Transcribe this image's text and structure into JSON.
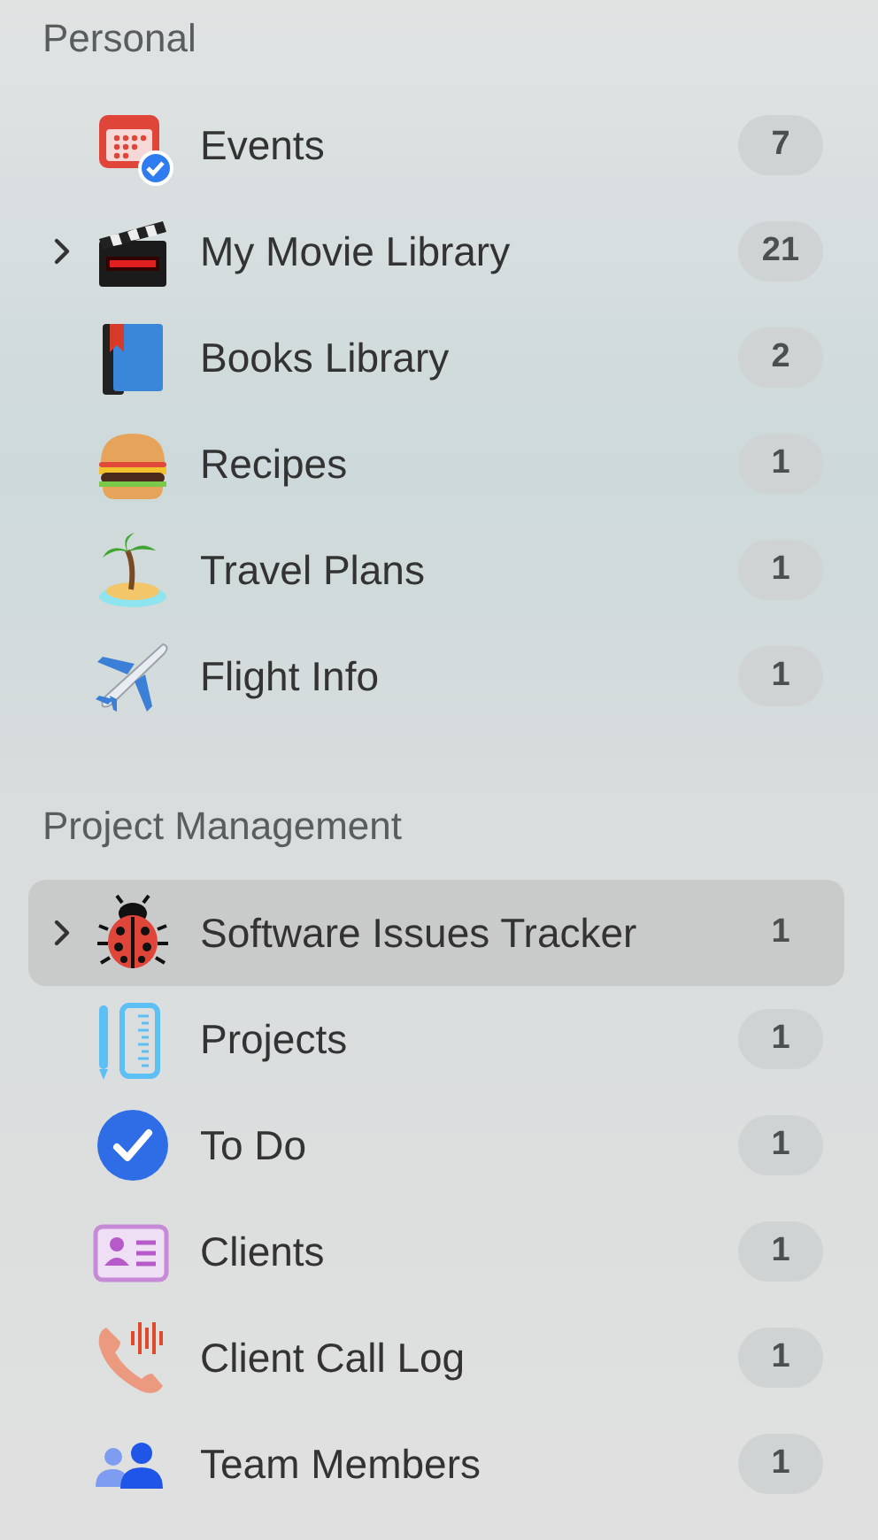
{
  "sections": [
    {
      "title": "Personal",
      "items": [
        {
          "label": "Events",
          "count": "7",
          "expandable": false,
          "selected": false
        },
        {
          "label": "My Movie Library",
          "count": "21",
          "expandable": true,
          "selected": false
        },
        {
          "label": "Books Library",
          "count": "2",
          "expandable": false,
          "selected": false
        },
        {
          "label": "Recipes",
          "count": "1",
          "expandable": false,
          "selected": false
        },
        {
          "label": "Travel Plans",
          "count": "1",
          "expandable": false,
          "selected": false
        },
        {
          "label": "Flight Info",
          "count": "1",
          "expandable": false,
          "selected": false
        }
      ]
    },
    {
      "title": "Project Management",
      "items": [
        {
          "label": "Software Issues Tracker",
          "count": "1",
          "expandable": true,
          "selected": true
        },
        {
          "label": "Projects",
          "count": "1",
          "expandable": false,
          "selected": false
        },
        {
          "label": "To Do",
          "count": "1",
          "expandable": false,
          "selected": false
        },
        {
          "label": "Clients",
          "count": "1",
          "expandable": false,
          "selected": false
        },
        {
          "label": "Client Call Log",
          "count": "1",
          "expandable": false,
          "selected": false
        },
        {
          "label": "Team Members",
          "count": "1",
          "expandable": false,
          "selected": false
        }
      ]
    }
  ]
}
